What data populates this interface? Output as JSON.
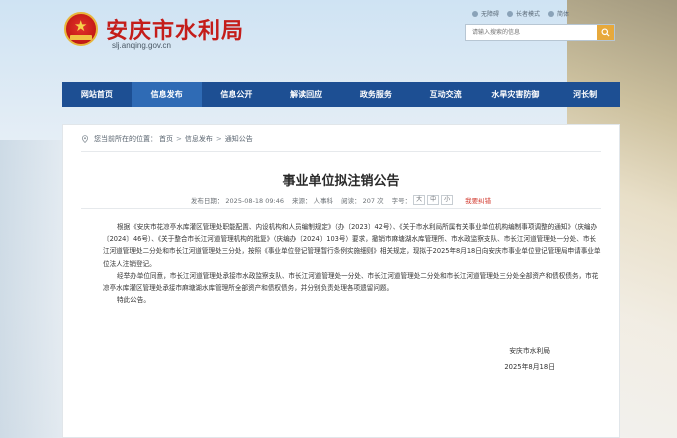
{
  "site": {
    "title": "安庆市水利局",
    "url": "slj.anqing.gov.cn"
  },
  "top_links": [
    {
      "label": "无障碍",
      "icon": "accessibility-icon"
    },
    {
      "label": "长者模式",
      "icon": "elder-mode-icon"
    },
    {
      "label": "简体",
      "icon": "simplified-chinese-icon"
    }
  ],
  "search": {
    "placeholder": "请输入搜索的信息"
  },
  "nav": {
    "items": [
      "网站首页",
      "信息发布",
      "信息公开",
      "解读回应",
      "政务服务",
      "互动交流",
      "水旱灾害防御",
      "河长制"
    ],
    "active_index": 1
  },
  "breadcrumb": {
    "prefix": "您当前所在的位置：",
    "items": [
      "首页",
      "信息发布",
      "通知公告"
    ],
    "separator": ">"
  },
  "article": {
    "title": "事业单位拟注销公告",
    "meta": {
      "publish_time": "发布日期： 2025-08-18 09:46",
      "source": "来源： 人事科",
      "views": "阅读： 207 次",
      "font_label": "字号：",
      "font_sizes": [
        "大",
        "中",
        "小"
      ],
      "report": "我要纠错"
    },
    "paragraphs": [
      "根据《安庆市花凉亭水库灌区管理处职能配置、内设机构和人员编制规定》（办〔2023〕42号）、《关于市水利局所属有关事业单位机构编制事项调整的通知》（庆编办〔2024〕46号）、《关于整合市长江河道管理机构的批复》（庆编办〔2024〕103号）要求，撤销市麻塘湖水库管理所、市水政监察支队、市长江河道管理处一分处、市长江河道管理处二分处和市长江河道管理处三分处，按照《事业单位登记管理暂行条例实施细则》相关规定，现拟于2025年8月18日向安庆市事业单位登记管理局申请事业单位法人注销登记。",
      "经举办单位同意，市长江河道管理处承接市水政监察支队、市长江河道管理处一分处、市长江河道管理处二分处和市长江河道管理处三分处全部资产和债权债务，市花凉亭水库灌区管理处承接市麻塘湖水库管理所全部资产和债权债务，并分别负责处理各项遗留问题。",
      "特此公告。"
    ],
    "signature": {
      "org": "安庆市水利局",
      "date": "2025年8月18日"
    }
  },
  "colors": {
    "brand_red": "#c41d1a",
    "nav_blue": "#1d4f93",
    "nav_active": "#2f6bb5",
    "search_button": "#e7a93c"
  }
}
